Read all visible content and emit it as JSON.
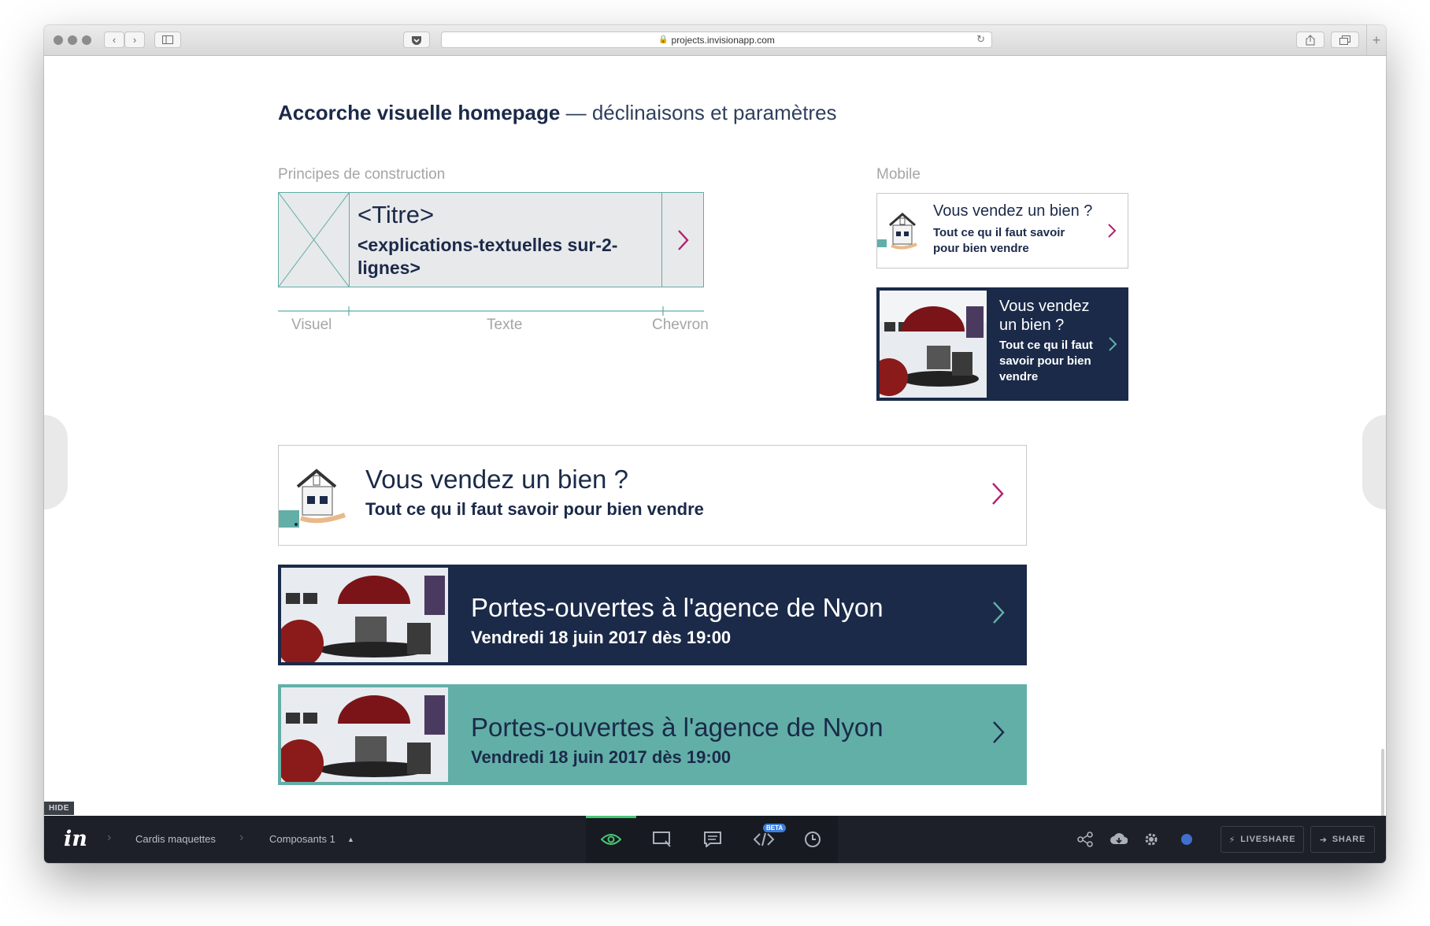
{
  "browser": {
    "url": "projects.invisionapp.com"
  },
  "page": {
    "title_bold": "Accorche visuelle homepage",
    "title_light": " — déclinaisons et paramètres",
    "section_construction": "Principes de construction",
    "section_mobile": "Mobile",
    "wire": {
      "title": "<Titre>",
      "subtitle": "<explications-textuelles sur-2-lignes>",
      "labels": [
        "Visuel",
        "Texte",
        "Chevron"
      ]
    },
    "mobile_cards": [
      {
        "title": "Vous vendez un bien ?",
        "subtitle": "Tout ce qu il faut savoir pour bien vendre"
      },
      {
        "title": "Vous vendez un bien ?",
        "subtitle": "Tout ce qu il faut savoir pour bien vendre"
      }
    ],
    "cards": [
      {
        "title": "Vous vendez un bien ?",
        "subtitle": "Tout ce qu il faut savoir pour bien vendre"
      },
      {
        "title": "Portes-ouvertes à l'agence de Nyon",
        "subtitle": "Vendredi 18 juin 2017 dès 19:00"
      },
      {
        "title": "Portes-ouvertes à l'agence de Nyon",
        "subtitle": "Vendredi 18 juin 2017 dès 19:00"
      }
    ]
  },
  "invision": {
    "logo": "in",
    "hide_label": "HIDE",
    "breadcrumb": [
      "Cardis maquettes",
      "Composants 1"
    ],
    "beta_label": "BETA",
    "liveshare_label": "LIVESHARE",
    "share_label": "SHARE",
    "tools": [
      "eye-icon",
      "comment-rect-icon",
      "chat-icon",
      "code-icon",
      "clock-icon"
    ]
  },
  "colors": {
    "navy": "#1b2a49",
    "teal": "#62afa8",
    "magenta": "#b0206f",
    "wire_border": "#5fada7"
  }
}
